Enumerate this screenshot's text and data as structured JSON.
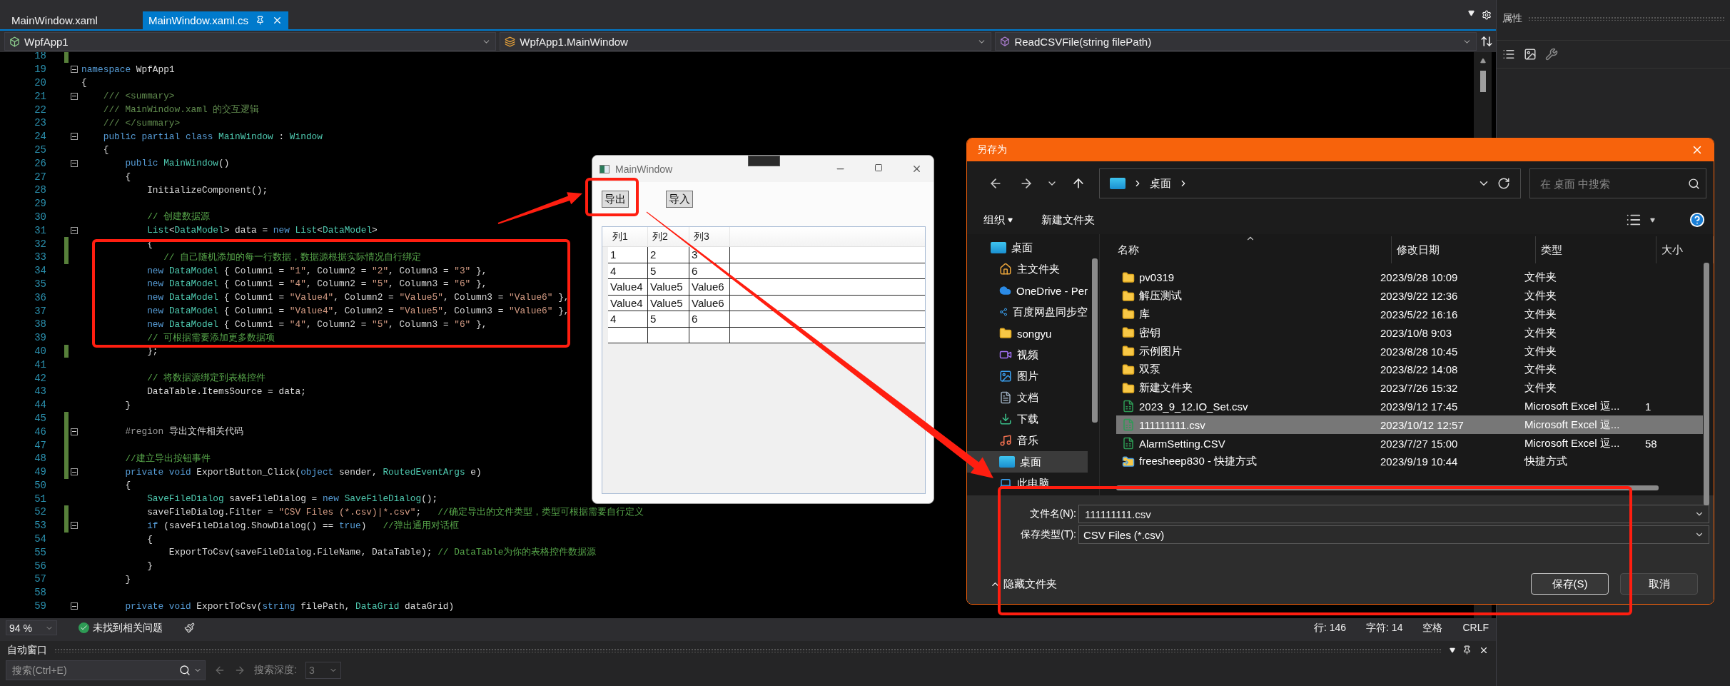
{
  "editor_tabs": [
    {
      "label": "MainWindow.xaml",
      "selected": false
    },
    {
      "label": "MainWindow.xaml.cs",
      "selected": true
    }
  ],
  "nav_bar": {
    "project": "WpfApp1",
    "class": "WpfApp1.MainWindow",
    "member": "ReadCSVFile(string filePath)"
  },
  "code_lines": [
    {
      "number": "18",
      "changed": true,
      "foldable": false
    },
    {
      "number": "19",
      "changed": false,
      "foldable": true,
      "tokens": [
        {
          "kind": "kw",
          "text": "namespace"
        },
        {
          "kind": "plain",
          "text": " WpfApp1"
        }
      ]
    },
    {
      "number": "20",
      "changed": false,
      "foldable": false,
      "tokens": [
        {
          "kind": "plain",
          "text": "{"
        }
      ]
    },
    {
      "number": "21",
      "changed": false,
      "foldable": true,
      "tokens": [
        {
          "kind": "doc",
          "text": "    /// <summary>"
        }
      ]
    },
    {
      "number": "22",
      "changed": false,
      "foldable": false,
      "tokens": [
        {
          "kind": "doc",
          "text": "    /// MainWindow.xaml 的交互逻辑"
        }
      ]
    },
    {
      "number": "23",
      "changed": false,
      "foldable": false,
      "tokens": [
        {
          "kind": "doc",
          "text": "    /// </summary>"
        }
      ]
    },
    {
      "number": "24",
      "changed": false,
      "foldable": true,
      "tokens": [
        {
          "kind": "kw",
          "text": "    public partial class"
        },
        {
          "kind": "type",
          "text": " MainWindow"
        },
        {
          "kind": "plain",
          "text": " : "
        },
        {
          "kind": "type",
          "text": "Window"
        }
      ]
    },
    {
      "number": "25",
      "changed": false,
      "foldable": false,
      "tokens": [
        {
          "kind": "plain",
          "text": "    {"
        }
      ]
    },
    {
      "number": "26",
      "changed": false,
      "foldable": true,
      "tokens": [
        {
          "kind": "kw",
          "text": "        public"
        },
        {
          "kind": "type",
          "text": " MainWindow"
        },
        {
          "kind": "plain",
          "text": "()"
        }
      ]
    },
    {
      "number": "27",
      "changed": false,
      "foldable": false,
      "tokens": [
        {
          "kind": "plain",
          "text": "        {"
        }
      ]
    },
    {
      "number": "28",
      "changed": false,
      "foldable": false,
      "tokens": [
        {
          "kind": "plain",
          "text": "            InitializeComponent();"
        }
      ]
    },
    {
      "number": "29",
      "changed": false,
      "foldable": false
    },
    {
      "number": "30",
      "changed": false,
      "foldable": false,
      "tokens": [
        {
          "kind": "comment",
          "text": "            // 创建数据源"
        }
      ]
    },
    {
      "number": "31",
      "changed": false,
      "foldable": true,
      "tokens": [
        {
          "kind": "type",
          "text": "            List"
        },
        {
          "kind": "plain",
          "text": "<"
        },
        {
          "kind": "type",
          "text": "DataModel"
        },
        {
          "kind": "plain",
          "text": "> data = "
        },
        {
          "kind": "kw",
          "text": "new"
        },
        {
          "kind": "type",
          "text": " List"
        },
        {
          "kind": "plain",
          "text": "<"
        },
        {
          "kind": "type",
          "text": "DataModel"
        },
        {
          "kind": "plain",
          "text": ">"
        }
      ]
    },
    {
      "number": "32",
      "changed": true,
      "foldable": false,
      "tokens": [
        {
          "kind": "plain",
          "text": "            {"
        }
      ]
    },
    {
      "number": "33",
      "changed": true,
      "foldable": false,
      "tokens": [
        {
          "kind": "comment",
          "text": "               // 自己随机添加的每一行数据，数据源根据实际情况自行绑定"
        }
      ]
    },
    {
      "number": "34",
      "changed": false,
      "foldable": false,
      "tokens": [
        {
          "kind": "kw",
          "text": "            new"
        },
        {
          "kind": "type",
          "text": " DataModel"
        },
        {
          "kind": "plain",
          "text": " { Column1 = "
        },
        {
          "kind": "str",
          "text": "\"1\""
        },
        {
          "kind": "plain",
          "text": ", Column2 = "
        },
        {
          "kind": "str",
          "text": "\"2\""
        },
        {
          "kind": "plain",
          "text": ", Column3 = "
        },
        {
          "kind": "str",
          "text": "\"3\""
        },
        {
          "kind": "plain",
          "text": " },"
        }
      ]
    },
    {
      "number": "35",
      "changed": false,
      "foldable": false,
      "tokens": [
        {
          "kind": "kw",
          "text": "            new"
        },
        {
          "kind": "type",
          "text": " DataModel"
        },
        {
          "kind": "plain",
          "text": " { Column1 = "
        },
        {
          "kind": "str",
          "text": "\"4\""
        },
        {
          "kind": "plain",
          "text": ", Column2 = "
        },
        {
          "kind": "str",
          "text": "\"5\""
        },
        {
          "kind": "plain",
          "text": ", Column3 = "
        },
        {
          "kind": "str",
          "text": "\"6\""
        },
        {
          "kind": "plain",
          "text": " },"
        }
      ]
    },
    {
      "number": "36",
      "changed": false,
      "foldable": false,
      "tokens": [
        {
          "kind": "kw",
          "text": "            new"
        },
        {
          "kind": "type",
          "text": " DataModel"
        },
        {
          "kind": "plain",
          "text": " { Column1 = "
        },
        {
          "kind": "str",
          "text": "\"Value4\""
        },
        {
          "kind": "plain",
          "text": ", Column2 = "
        },
        {
          "kind": "str",
          "text": "\"Value5\""
        },
        {
          "kind": "plain",
          "text": ", Column3 = "
        },
        {
          "kind": "str",
          "text": "\"Value6\""
        },
        {
          "kind": "plain",
          "text": " },"
        }
      ]
    },
    {
      "number": "37",
      "changed": false,
      "foldable": false,
      "tokens": [
        {
          "kind": "kw",
          "text": "            new"
        },
        {
          "kind": "type",
          "text": " DataModel"
        },
        {
          "kind": "plain",
          "text": " { Column1 = "
        },
        {
          "kind": "str",
          "text": "\"Value4\""
        },
        {
          "kind": "plain",
          "text": ", Column2 = "
        },
        {
          "kind": "str",
          "text": "\"Value5\""
        },
        {
          "kind": "plain",
          "text": ", Column3 = "
        },
        {
          "kind": "str",
          "text": "\"Value6\""
        },
        {
          "kind": "plain",
          "text": " },"
        }
      ]
    },
    {
      "number": "38",
      "changed": false,
      "foldable": false,
      "tokens": [
        {
          "kind": "kw",
          "text": "            new"
        },
        {
          "kind": "type",
          "text": " DataModel"
        },
        {
          "kind": "plain",
          "text": " { Column1 = "
        },
        {
          "kind": "str",
          "text": "\"4\""
        },
        {
          "kind": "plain",
          "text": ", Column2 = "
        },
        {
          "kind": "str",
          "text": "\"5\""
        },
        {
          "kind": "plain",
          "text": ", Column3 = "
        },
        {
          "kind": "str",
          "text": "\"6\""
        },
        {
          "kind": "plain",
          "text": " },"
        }
      ]
    },
    {
      "number": "39",
      "changed": false,
      "foldable": false,
      "tokens": [
        {
          "kind": "comment",
          "text": "            // 可根据需要添加更多数据项"
        }
      ]
    },
    {
      "number": "40",
      "changed": true,
      "foldable": false,
      "tokens": [
        {
          "kind": "plain",
          "text": "            };"
        }
      ]
    },
    {
      "number": "41",
      "changed": false,
      "foldable": false
    },
    {
      "number": "42",
      "changed": false,
      "foldable": false,
      "tokens": [
        {
          "kind": "comment",
          "text": "            // 将数据源绑定到表格控件"
        }
      ]
    },
    {
      "number": "43",
      "changed": false,
      "foldable": false,
      "tokens": [
        {
          "kind": "plain",
          "text": "            DataTable.ItemsSource = data;"
        }
      ]
    },
    {
      "number": "44",
      "changed": false,
      "foldable": false,
      "tokens": [
        {
          "kind": "plain",
          "text": "        }"
        }
      ]
    },
    {
      "number": "45",
      "changed": true,
      "foldable": false
    },
    {
      "number": "46",
      "changed": true,
      "foldable": true,
      "tokens": [
        {
          "kind": "directive",
          "text": "        #region"
        },
        {
          "kind": "plain",
          "text": " 导出文件相关代码"
        }
      ]
    },
    {
      "number": "47",
      "changed": true,
      "foldable": false
    },
    {
      "number": "48",
      "changed": true,
      "foldable": false,
      "tokens": [
        {
          "kind": "comment",
          "text": "        //建立导出按钮事件"
        }
      ]
    },
    {
      "number": "49",
      "changed": true,
      "foldable": true,
      "tokens": [
        {
          "kind": "kw",
          "text": "        private void"
        },
        {
          "kind": "plain",
          "text": " ExportButton_Click("
        },
        {
          "kind": "kw",
          "text": "object"
        },
        {
          "kind": "plain",
          "text": " sender, "
        },
        {
          "kind": "type",
          "text": "RoutedEventArgs"
        },
        {
          "kind": "plain",
          "text": " e)"
        }
      ]
    },
    {
      "number": "50",
      "changed": false,
      "foldable": false,
      "tokens": [
        {
          "kind": "plain",
          "text": "        {"
        }
      ]
    },
    {
      "number": "51",
      "changed": false,
      "foldable": false,
      "tokens": [
        {
          "kind": "type",
          "text": "            SaveFileDialog"
        },
        {
          "kind": "plain",
          "text": " saveFileDialog = "
        },
        {
          "kind": "kw",
          "text": "new"
        },
        {
          "kind": "type",
          "text": " SaveFileDialog"
        },
        {
          "kind": "plain",
          "text": "();"
        }
      ]
    },
    {
      "number": "52",
      "changed": true,
      "foldable": false,
      "tokens": [
        {
          "kind": "plain",
          "text": "            saveFileDialog.Filter = "
        },
        {
          "kind": "str",
          "text": "\"CSV Files (*.csv)|*.csv\""
        },
        {
          "kind": "plain",
          "text": ";   "
        },
        {
          "kind": "comment",
          "text": "//确定导出的文件类型，类型可根据需要自行定义"
        }
      ]
    },
    {
      "number": "53",
      "changed": true,
      "foldable": true,
      "tokens": [
        {
          "kind": "kw",
          "text": "            if"
        },
        {
          "kind": "plain",
          "text": " (saveFileDialog.ShowDialog() == "
        },
        {
          "kind": "kw",
          "text": "true"
        },
        {
          "kind": "plain",
          "text": ")   "
        },
        {
          "kind": "comment",
          "text": "//弹出通用对话框"
        }
      ]
    },
    {
      "number": "54",
      "changed": false,
      "foldable": false,
      "tokens": [
        {
          "kind": "plain",
          "text": "            {"
        }
      ]
    },
    {
      "number": "55",
      "changed": false,
      "foldable": false,
      "tokens": [
        {
          "kind": "plain",
          "text": "                ExportToCsv(saveFileDialog.FileName, DataTable); "
        },
        {
          "kind": "comment",
          "text": "// DataTable为你的表格控件数据源"
        }
      ]
    },
    {
      "number": "56",
      "changed": false,
      "foldable": false,
      "tokens": [
        {
          "kind": "plain",
          "text": "            }"
        }
      ]
    },
    {
      "number": "57",
      "changed": false,
      "foldable": false,
      "tokens": [
        {
          "kind": "plain",
          "text": "        }"
        }
      ]
    },
    {
      "number": "58",
      "changed": false,
      "foldable": false
    },
    {
      "number": "59",
      "changed": false,
      "foldable": true,
      "tokens": [
        {
          "kind": "kw",
          "text": "        private void"
        },
        {
          "kind": "plain",
          "text": " ExportToCsv("
        },
        {
          "kind": "kw",
          "text": "string"
        },
        {
          "kind": "plain",
          "text": " filePath, "
        },
        {
          "kind": "type",
          "text": "DataGrid"
        },
        {
          "kind": "plain",
          "text": " dataGrid)"
        }
      ]
    }
  ],
  "status_bar": {
    "zoom": "94 %",
    "issues": "未找到相关问题",
    "line": "行: 146",
    "column": "字符: 14",
    "indent": "空格",
    "line_ending": "CRLF"
  },
  "auto_window": {
    "title": "自动窗口",
    "search": {
      "placeholder": "搜索(Ctrl+E)"
    },
    "depth_label": "搜索深度:",
    "depth": "3"
  },
  "properties_panel": {
    "title": "属性"
  },
  "main_window": {
    "title": "MainWindow",
    "buttons": [
      "导出",
      "导入"
    ],
    "grid": {
      "columns": [
        "列1",
        "列2",
        "列3"
      ],
      "rows": [
        {
          "cells": [
            "1",
            "2",
            "3"
          ]
        },
        {
          "cells": [
            "4",
            "5",
            "6"
          ]
        },
        {
          "cells": [
            "Value4",
            "Value5",
            "Value6"
          ]
        },
        {
          "cells": [
            "Value4",
            "Value5",
            "Value6"
          ]
        },
        {
          "cells": [
            "4",
            "5",
            "6"
          ]
        }
      ],
      "new_item_row": true
    }
  },
  "save_dialog": {
    "title": "另存为",
    "address": "桌面",
    "search": {
      "placeholder": "在 桌面 中搜索"
    },
    "toolbar": [
      {
        "label": "组织",
        "kind": "menu"
      },
      {
        "label": "新建文件夹",
        "kind": "button"
      }
    ],
    "nav_items": [
      {
        "label": "桌面",
        "kind": "desktop",
        "selected": false,
        "children": [
          {
            "label": "主文件夹",
            "kind": "home",
            "selected": false
          },
          {
            "label": "OneDrive - Per",
            "kind": "cloud",
            "selected": false
          },
          {
            "label": "百度网盘同步空",
            "kind": "sync",
            "selected": false
          },
          {
            "label": "songyu",
            "kind": "folder",
            "selected": false
          },
          {
            "label": "视频",
            "kind": "video",
            "selected": false
          },
          {
            "label": "图片",
            "kind": "picture",
            "selected": false
          },
          {
            "label": "文档",
            "kind": "document",
            "selected": false
          },
          {
            "label": "下载",
            "kind": "download",
            "selected": false
          },
          {
            "label": "音乐",
            "kind": "music",
            "selected": false
          },
          {
            "label": "桌面",
            "kind": "desktop",
            "selected": true
          },
          {
            "label": "此电脑",
            "kind": "pc",
            "selected": false
          }
        ]
      }
    ],
    "columns": [
      {
        "label": "名称",
        "sorted": true
      },
      {
        "label": "修改日期",
        "sorted": false
      },
      {
        "label": "类型",
        "sorted": false
      },
      {
        "label": "大小",
        "sorted": false
      }
    ],
    "files": [
      {
        "name": "pv0319",
        "date": "2023/9/28 10:09",
        "type": "文件夹",
        "kind": "folder",
        "selected": false
      },
      {
        "name": "解压测试",
        "date": "2023/9/22 12:36",
        "type": "文件夹",
        "kind": "folder",
        "selected": false
      },
      {
        "name": "库",
        "date": "2023/5/22 16:16",
        "type": "文件夹",
        "kind": "folder",
        "selected": false
      },
      {
        "name": "密钥",
        "date": "2023/10/8 9:03",
        "type": "文件夹",
        "kind": "folder",
        "selected": false
      },
      {
        "name": "示例图片",
        "date": "2023/8/28 10:45",
        "type": "文件夹",
        "kind": "folder",
        "selected": false
      },
      {
        "name": "双泵",
        "date": "2023/8/22 14:08",
        "type": "文件夹",
        "kind": "folder",
        "selected": false
      },
      {
        "name": "新建文件夹",
        "date": "2023/7/26 15:32",
        "type": "文件夹",
        "kind": "folder",
        "selected": false
      },
      {
        "name": "2023_9_12.IO_Set.csv",
        "date": "2023/9/12 17:45",
        "type": "Microsoft Excel 逗...",
        "size": "1",
        "kind": "excel",
        "selected": false
      },
      {
        "name": "111111111.csv",
        "date": "2023/10/12 12:57",
        "type": "Microsoft Excel 逗...",
        "kind": "excel",
        "selected": true
      },
      {
        "name": "AlarmSetting.CSV",
        "date": "2023/7/27 15:00",
        "type": "Microsoft Excel 逗...",
        "size": "58",
        "kind": "excel",
        "selected": false
      },
      {
        "name": "freesheep830 - 快捷方式",
        "date": "2023/9/19 10:44",
        "type": "快捷方式",
        "kind": "shortcut",
        "selected": false
      }
    ],
    "file_name_label": "文件名(N):",
    "file_name": "111111111.csv",
    "file_type_label": "保存类型(T):",
    "file_type": "CSV Files (*.csv)",
    "hide_folders": "隐藏文件夹",
    "buttons": [
      {
        "label": "保存(S)",
        "kind": "primary"
      },
      {
        "label": "取消",
        "kind": "secondary"
      }
    ]
  }
}
